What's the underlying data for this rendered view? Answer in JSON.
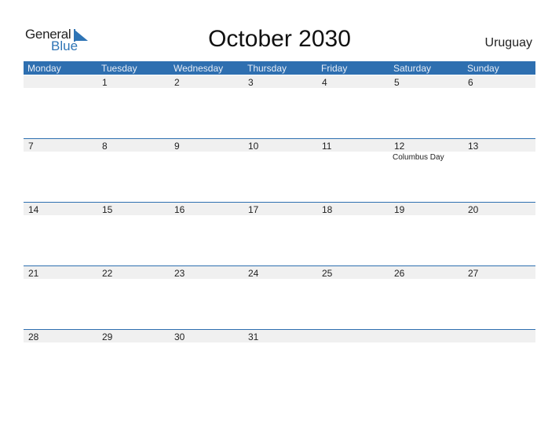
{
  "logo": {
    "text_top": "General",
    "text_bottom": "Blue",
    "icon": "triangle-flag-icon"
  },
  "title": "October 2030",
  "country": "Uruguay",
  "colors": {
    "accent": "#2e6fb0",
    "strip": "#f0f0f0"
  },
  "weekdays": [
    "Monday",
    "Tuesday",
    "Wednesday",
    "Thursday",
    "Friday",
    "Saturday",
    "Sunday"
  ],
  "weeks": [
    {
      "days": [
        {
          "num": "",
          "event": ""
        },
        {
          "num": "1",
          "event": ""
        },
        {
          "num": "2",
          "event": ""
        },
        {
          "num": "3",
          "event": ""
        },
        {
          "num": "4",
          "event": ""
        },
        {
          "num": "5",
          "event": ""
        },
        {
          "num": "6",
          "event": ""
        }
      ]
    },
    {
      "days": [
        {
          "num": "7",
          "event": ""
        },
        {
          "num": "8",
          "event": ""
        },
        {
          "num": "9",
          "event": ""
        },
        {
          "num": "10",
          "event": ""
        },
        {
          "num": "11",
          "event": ""
        },
        {
          "num": "12",
          "event": "Columbus Day"
        },
        {
          "num": "13",
          "event": ""
        }
      ]
    },
    {
      "days": [
        {
          "num": "14",
          "event": ""
        },
        {
          "num": "15",
          "event": ""
        },
        {
          "num": "16",
          "event": ""
        },
        {
          "num": "17",
          "event": ""
        },
        {
          "num": "18",
          "event": ""
        },
        {
          "num": "19",
          "event": ""
        },
        {
          "num": "20",
          "event": ""
        }
      ]
    },
    {
      "days": [
        {
          "num": "21",
          "event": ""
        },
        {
          "num": "22",
          "event": ""
        },
        {
          "num": "23",
          "event": ""
        },
        {
          "num": "24",
          "event": ""
        },
        {
          "num": "25",
          "event": ""
        },
        {
          "num": "26",
          "event": ""
        },
        {
          "num": "27",
          "event": ""
        }
      ]
    },
    {
      "days": [
        {
          "num": "28",
          "event": ""
        },
        {
          "num": "29",
          "event": ""
        },
        {
          "num": "30",
          "event": ""
        },
        {
          "num": "31",
          "event": ""
        },
        {
          "num": "",
          "event": ""
        },
        {
          "num": "",
          "event": ""
        },
        {
          "num": "",
          "event": ""
        }
      ]
    }
  ]
}
